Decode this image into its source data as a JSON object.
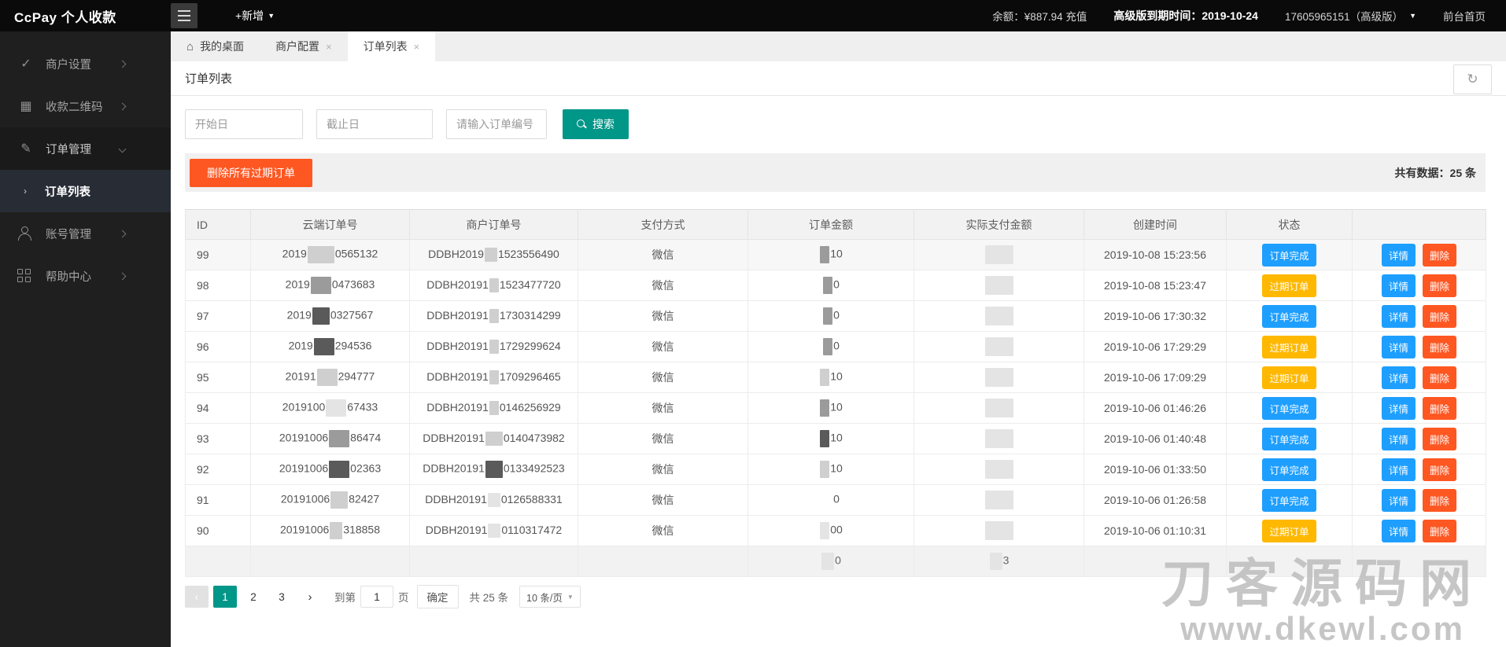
{
  "header": {
    "brand": "CcPay 个人收款",
    "new_button": "+新增",
    "balance": "余额：¥887.94 充值",
    "expire": "高级版到期时间：2019-10-24",
    "account": "17605965151（高级版）",
    "front_home": "前台首页"
  },
  "sidebar": {
    "items": [
      {
        "label": "商户设置"
      },
      {
        "label": "收款二维码"
      },
      {
        "label": "订单管理"
      },
      {
        "label": "账号管理"
      },
      {
        "label": "帮助中心"
      }
    ],
    "active_sub": "订单列表"
  },
  "tabs": [
    {
      "label": "我的桌面"
    },
    {
      "label": "商户配置"
    },
    {
      "label": "订单列表"
    }
  ],
  "page": {
    "title": "订单列表"
  },
  "search": {
    "start_placeholder": "开始日",
    "end_placeholder": "截止日",
    "order_placeholder": "请输入订单编号",
    "button": "搜索"
  },
  "toolbar": {
    "delete_all": "删除所有过期订单",
    "total_label": "共有数据：25 条"
  },
  "table": {
    "columns": [
      "ID",
      "云端订单号",
      "商户订单号",
      "支付方式",
      "订单金额",
      "实际支付金额",
      "创建时间",
      "状态",
      ""
    ],
    "actions": {
      "detail": "详情",
      "delete": "删除"
    },
    "status_colors": {
      "done": "#1E9FFF",
      "expired": "#FFB800"
    },
    "rows": [
      {
        "id": "99",
        "cloud_prefix": "2019",
        "cloud_suffix": "0565132",
        "merchant_prefix": "DDBH2019",
        "merchant_suffix": "1523556490",
        "pay": "微信",
        "amount": "10",
        "created": "2019-10-08 15:23:56",
        "status": "done",
        "status_label": "订单完成"
      },
      {
        "id": "98",
        "cloud_prefix": "2019",
        "cloud_suffix": "0473683",
        "merchant_prefix": "DDBH20191",
        "merchant_suffix": "1523477720",
        "pay": "微信",
        "amount": "0",
        "created": "2019-10-08 15:23:47",
        "status": "expired",
        "status_label": "过期订单"
      },
      {
        "id": "97",
        "cloud_prefix": "2019",
        "cloud_suffix": "0327567",
        "merchant_prefix": "DDBH20191",
        "merchant_suffix": "1730314299",
        "pay": "微信",
        "amount": "0",
        "created": "2019-10-06 17:30:32",
        "status": "done",
        "status_label": "订单完成"
      },
      {
        "id": "96",
        "cloud_prefix": "2019",
        "cloud_suffix": "294536",
        "merchant_prefix": "DDBH20191",
        "merchant_suffix": "1729299624",
        "pay": "微信",
        "amount": "0",
        "created": "2019-10-06 17:29:29",
        "status": "expired",
        "status_label": "过期订单"
      },
      {
        "id": "95",
        "cloud_prefix": "20191",
        "cloud_suffix": "294777",
        "merchant_prefix": "DDBH20191",
        "merchant_suffix": "1709296465",
        "pay": "微信",
        "amount": "10",
        "created": "2019-10-06 17:09:29",
        "status": "expired",
        "status_label": "过期订单"
      },
      {
        "id": "94",
        "cloud_prefix": "2019100",
        "cloud_suffix": "67433",
        "merchant_prefix": "DDBH20191",
        "merchant_suffix": "0146256929",
        "pay": "微信",
        "amount": "10",
        "created": "2019-10-06 01:46:26",
        "status": "done",
        "status_label": "订单完成"
      },
      {
        "id": "93",
        "cloud_prefix": "20191006",
        "cloud_suffix": "86474",
        "merchant_prefix": "DDBH20191",
        "merchant_suffix": "0140473982",
        "pay": "微信",
        "amount": "10",
        "created": "2019-10-06 01:40:48",
        "status": "done",
        "status_label": "订单完成"
      },
      {
        "id": "92",
        "cloud_prefix": "20191006",
        "cloud_suffix": "02363",
        "merchant_prefix": "DDBH20191",
        "merchant_suffix": "0133492523",
        "pay": "微信",
        "amount": "10",
        "created": "2019-10-06 01:33:50",
        "status": "done",
        "status_label": "订单完成"
      },
      {
        "id": "91",
        "cloud_prefix": "20191006",
        "cloud_suffix": "82427",
        "merchant_prefix": "DDBH20191",
        "merchant_suffix": "0126588331",
        "pay": "微信",
        "amount": "0",
        "created": "2019-10-06 01:26:58",
        "status": "done",
        "status_label": "订单完成"
      },
      {
        "id": "90",
        "cloud_prefix": "20191006",
        "cloud_suffix": "318858",
        "merchant_prefix": "DDBH20191",
        "merchant_suffix": "0110317472",
        "pay": "微信",
        "amount": "00",
        "created": "2019-10-06 01:10:31",
        "status": "expired",
        "status_label": "过期订单"
      }
    ],
    "summary": {
      "amount": "0",
      "actual": "3"
    }
  },
  "pagination": {
    "prev": "‹",
    "pages": [
      "1",
      "2",
      "3"
    ],
    "next": "›",
    "goto_label": "到第",
    "page_value": "1",
    "page_unit": "页",
    "confirm": "确定",
    "total": "共 25 条",
    "per_page": "10 条/页"
  },
  "watermark": {
    "line1": "刀客源码网",
    "line2": "www.dkewl.com"
  }
}
